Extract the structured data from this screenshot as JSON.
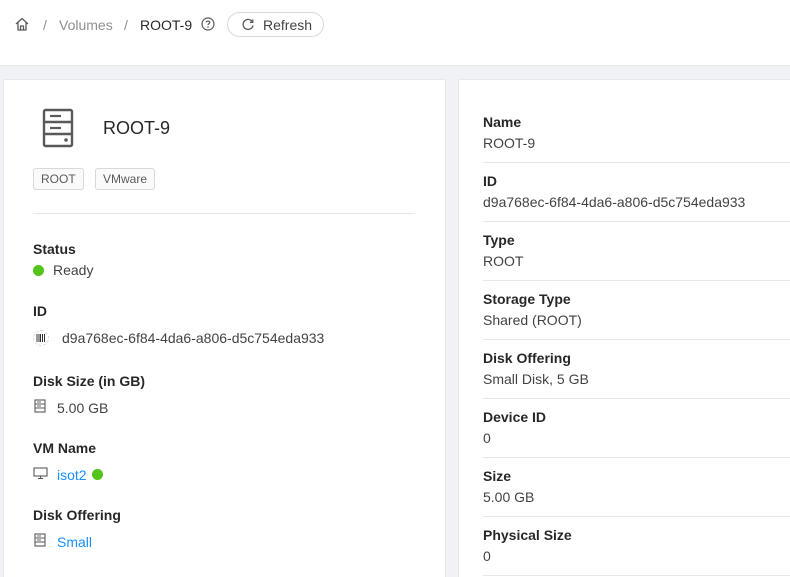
{
  "breadcrumb": {
    "home_icon": "home-icon",
    "separator": "/",
    "volumes": "Volumes",
    "current": "ROOT-9",
    "help_icon": "question-circle-icon"
  },
  "toolbar": {
    "refresh_label": "Refresh",
    "refresh_icon": "reload-icon"
  },
  "resource": {
    "icon": "hdd-icon",
    "name": "ROOT-9",
    "tags": [
      "ROOT",
      "VMware"
    ]
  },
  "details_left": {
    "status": {
      "label": "Status",
      "value": "Ready",
      "color": "#52c41a"
    },
    "id": {
      "label": "ID",
      "value": "d9a768ec-6f84-4da6-a806-d5c754eda933",
      "icon": "barcode-icon"
    },
    "disk_size": {
      "label": "Disk Size (in GB)",
      "value": "5.00 GB",
      "icon": "hdd-icon"
    },
    "vm_name": {
      "label": "VM Name",
      "value": "isot2",
      "icon": "desktop-icon",
      "status_color": "#52c41a"
    },
    "disk_offering": {
      "label": "Disk Offering",
      "value": "Small",
      "icon": "hdd-icon"
    }
  },
  "details_right": [
    {
      "label": "Name",
      "value": "ROOT-9"
    },
    {
      "label": "ID",
      "value": "d9a768ec-6f84-4da6-a806-d5c754eda933"
    },
    {
      "label": "Type",
      "value": "ROOT"
    },
    {
      "label": "Storage Type",
      "value": "Shared (ROOT)"
    },
    {
      "label": "Disk Offering",
      "value": "Small Disk, 5 GB"
    },
    {
      "label": "Device ID",
      "value": "0"
    },
    {
      "label": "Size",
      "value": "5.00 GB"
    },
    {
      "label": "Physical Size",
      "value": "0"
    }
  ],
  "colors": {
    "link": "#1890ff",
    "success": "#52c41a",
    "background": "#f0f2f5"
  }
}
